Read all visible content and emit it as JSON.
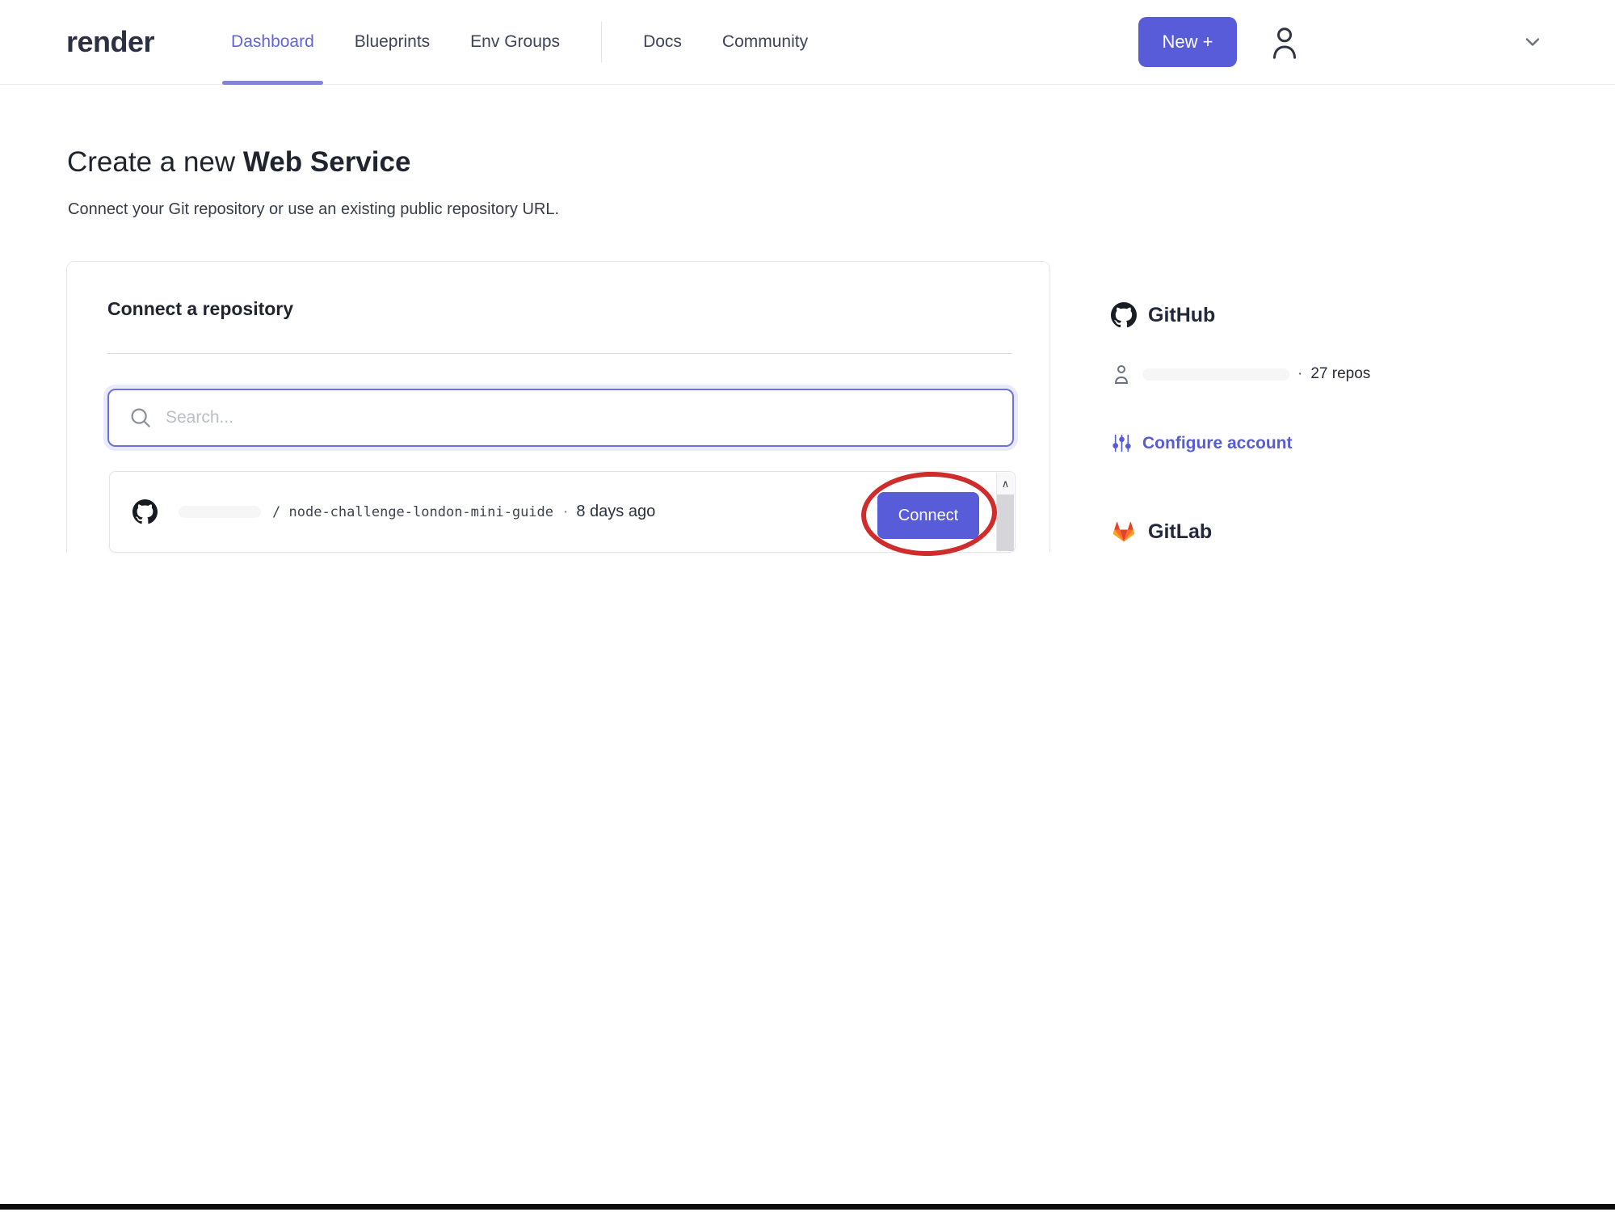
{
  "brand": {
    "logo": "render"
  },
  "nav": {
    "items": [
      {
        "label": "Dashboard",
        "active": true
      },
      {
        "label": "Blueprints",
        "active": false
      },
      {
        "label": "Env Groups",
        "active": false
      },
      {
        "label": "Docs",
        "active": false
      },
      {
        "label": "Community",
        "active": false
      }
    ],
    "new_button_label": "New +"
  },
  "page": {
    "title_prefix": "Create a new ",
    "title_emphasis": "Web Service",
    "subtitle": "Connect your Git repository or use an existing public repository URL."
  },
  "card": {
    "title": "Connect a repository",
    "search_placeholder": "Search...",
    "repo": {
      "path_prefix": "/",
      "name": "node-challenge-london-mini-guide",
      "dot": "·",
      "updated": "8 days ago",
      "connect_label": "Connect"
    },
    "scroll_up_glyph": "∧"
  },
  "providers": {
    "github": {
      "title": "GitHub",
      "dot": "·",
      "repo_count": "27 repos",
      "configure_label": "Configure account"
    },
    "gitlab": {
      "title": "GitLab"
    }
  },
  "colors": {
    "accent": "#585cd9",
    "nav_active": "#6165d7",
    "link": "#575cd4",
    "annotation_red": "#cf2c2c",
    "gitlab_orange": "#e24329",
    "bottom_bar": "#0b0b0b"
  }
}
